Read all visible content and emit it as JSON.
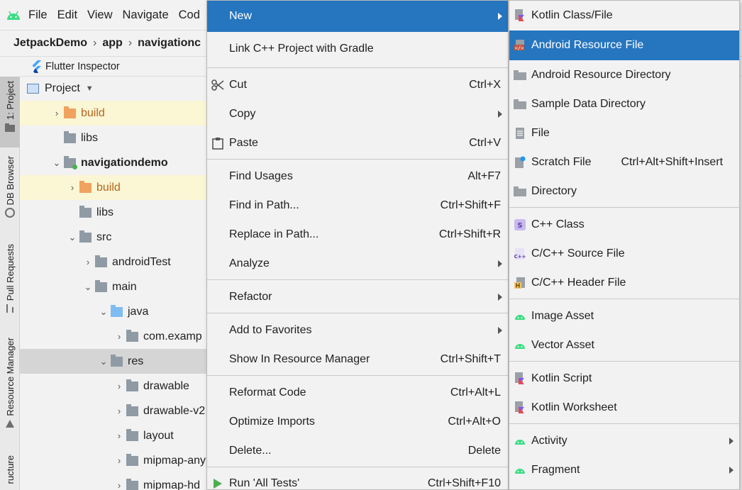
{
  "menubar": {
    "items": [
      "File",
      "Edit",
      "View",
      "Navigate",
      "Cod"
    ]
  },
  "breadcrumb": {
    "items": [
      "JetpackDemo",
      "app",
      "navigationc"
    ]
  },
  "tab": {
    "label": "Flutter Inspector"
  },
  "toolstrip": {
    "tabs": [
      "1: Project",
      "DB Browser",
      "Pull Requests",
      "Resource Manager",
      "ructure"
    ]
  },
  "project_view": {
    "header": "Project",
    "rows": [
      "build",
      "libs",
      "navigationdemo",
      "build",
      "libs",
      "src",
      "androidTest",
      "main",
      "java",
      "com.examp",
      "res",
      "drawable",
      "drawable-v2",
      "layout",
      "mipmap-any",
      "mipmap-hd"
    ]
  },
  "context_menu": {
    "items": [
      {
        "label": "New",
        "shortcut": ""
      },
      {
        "label": "Link C++ Project with Gradle",
        "shortcut": ""
      },
      {
        "label": "Cut",
        "shortcut": "Ctrl+X"
      },
      {
        "label": "Copy",
        "shortcut": ""
      },
      {
        "label": "Paste",
        "shortcut": "Ctrl+V"
      },
      {
        "label": "Find Usages",
        "shortcut": "Alt+F7"
      },
      {
        "label": "Find in Path...",
        "shortcut": "Ctrl+Shift+F"
      },
      {
        "label": "Replace in Path...",
        "shortcut": "Ctrl+Shift+R"
      },
      {
        "label": "Analyze",
        "shortcut": ""
      },
      {
        "label": "Refactor",
        "shortcut": ""
      },
      {
        "label": "Add to Favorites",
        "shortcut": ""
      },
      {
        "label": "Show In Resource Manager",
        "shortcut": "Ctrl+Shift+T"
      },
      {
        "label": "Reformat Code",
        "shortcut": "Ctrl+Alt+L"
      },
      {
        "label": "Optimize Imports",
        "shortcut": "Ctrl+Alt+O"
      },
      {
        "label": "Delete...",
        "shortcut": "Delete"
      },
      {
        "label": "Run 'All Tests'",
        "shortcut": "Ctrl+Shift+F10"
      }
    ]
  },
  "submenu": {
    "items": [
      {
        "label": "Kotlin Class/File",
        "shortcut": ""
      },
      {
        "label": "Android Resource File",
        "shortcut": ""
      },
      {
        "label": "Android Resource Directory",
        "shortcut": ""
      },
      {
        "label": "Sample Data Directory",
        "shortcut": ""
      },
      {
        "label": "File",
        "shortcut": ""
      },
      {
        "label": "Scratch File",
        "shortcut": "Ctrl+Alt+Shift+Insert"
      },
      {
        "label": "Directory",
        "shortcut": ""
      },
      {
        "label": "C++ Class",
        "shortcut": ""
      },
      {
        "label": "C/C++ Source File",
        "shortcut": ""
      },
      {
        "label": "C/C++ Header File",
        "shortcut": ""
      },
      {
        "label": "Image Asset",
        "shortcut": ""
      },
      {
        "label": "Vector Asset",
        "shortcut": ""
      },
      {
        "label": "Kotlin Script",
        "shortcut": ""
      },
      {
        "label": "Kotlin Worksheet",
        "shortcut": ""
      },
      {
        "label": "Activity",
        "shortcut": ""
      },
      {
        "label": "Fragment",
        "shortcut": ""
      }
    ]
  },
  "icon_glyphs": {
    "cpp_class": "S",
    "cpp_source": "C++",
    "cpp_header": "H"
  },
  "colors": {
    "selection": "#2675bf",
    "android_green": "#3ddc84",
    "kotlin_purple": "#7f52ff"
  }
}
